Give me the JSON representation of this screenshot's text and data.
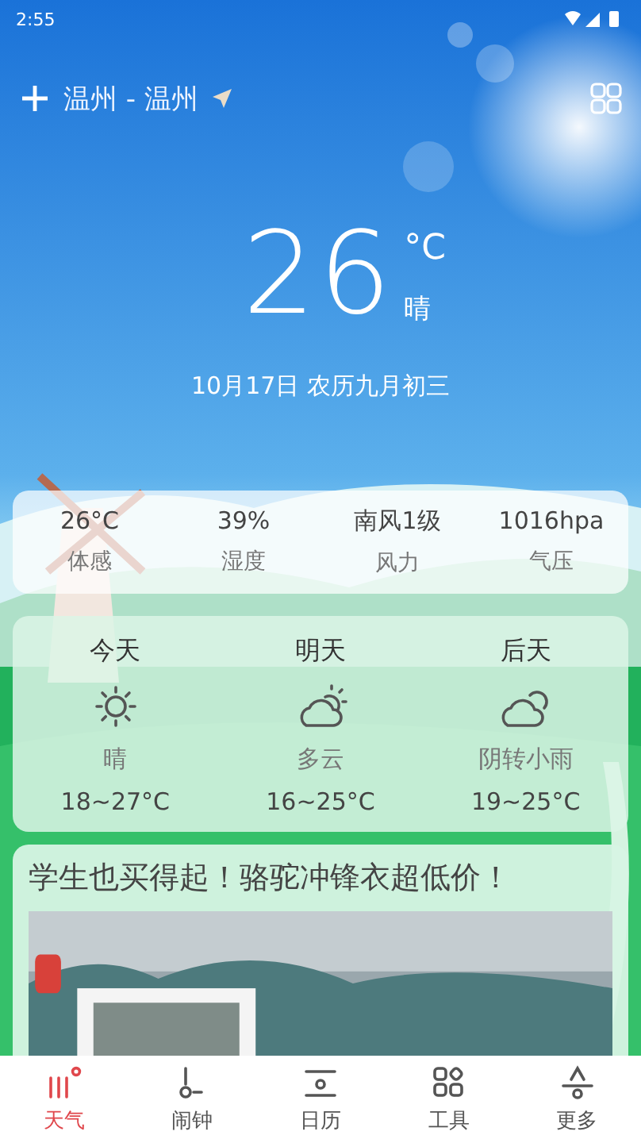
{
  "status_bar": {
    "time": "2:55"
  },
  "header": {
    "location": "温州 - 温州"
  },
  "current": {
    "temperature": "26",
    "unit": "°C",
    "condition": "晴",
    "date": "10月17日 农历九月初三"
  },
  "metrics": [
    {
      "value": "26°C",
      "label": "体感"
    },
    {
      "value": "39%",
      "label": "湿度"
    },
    {
      "value": "南风1级",
      "label": "风力"
    },
    {
      "value": "1016hpa",
      "label": "气压"
    }
  ],
  "forecast": [
    {
      "day": "今天",
      "kind": "sunny",
      "condition": "晴",
      "range": "18~27°C"
    },
    {
      "day": "明天",
      "kind": "cloudy",
      "condition": "多云",
      "range": "16~25°C"
    },
    {
      "day": "后天",
      "kind": "overcast",
      "condition": "阴转小雨",
      "range": "19~25°C"
    }
  ],
  "ad": {
    "title": "学生也买得起！骆驼冲锋衣超低价！"
  },
  "tabs": [
    {
      "label": "天气",
      "kind": "weather",
      "selected": true
    },
    {
      "label": "闹钟",
      "kind": "alarm",
      "selected": false
    },
    {
      "label": "日历",
      "kind": "calendar",
      "selected": false
    },
    {
      "label": "工具",
      "kind": "tools",
      "selected": false
    },
    {
      "label": "更多",
      "kind": "more",
      "selected": false
    }
  ]
}
